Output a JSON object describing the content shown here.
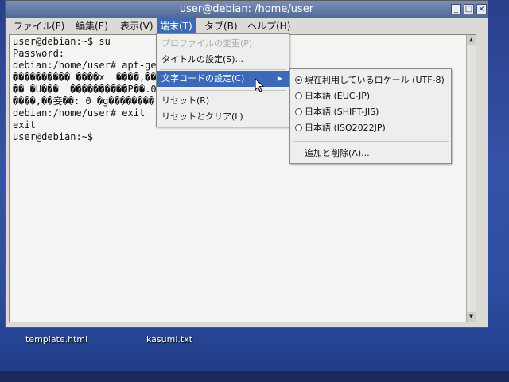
{
  "window": {
    "title": "user@debian: /home/user",
    "min": "_",
    "max": "□",
    "close": "×"
  },
  "menubar": [
    {
      "label": "ファイル(F)"
    },
    {
      "label": "編集(E)"
    },
    {
      "label": "表示(V)"
    },
    {
      "label": "端末(T)"
    },
    {
      "label": "タブ(B)"
    },
    {
      "label": "ヘルプ(H)"
    }
  ],
  "terminal": {
    "lines": [
      "user@debian:~$ su",
      "Password:",
      "debian:/home/user# apt-ge",
      "���������� ����x  ����,��",
      "�� �U���  ����������P��.0.",
      "����,��妾��: 0 �g��������",
      "debian:/home/user# exit",
      "exit",
      "user@debian:~$"
    ]
  },
  "terminal_menu": {
    "items": [
      {
        "label": "プロファイルの変更(P)",
        "state": "disabled"
      },
      {
        "label": "タイトルの設定(S)...",
        "state": "normal"
      },
      {
        "label": "文字コードの設定(C)",
        "state": "active",
        "submenu": true
      },
      {
        "label": "リセット(R)",
        "state": "normal"
      },
      {
        "label": "リセットとクリア(L)",
        "state": "normal"
      }
    ]
  },
  "encoding_submenu": {
    "items": [
      {
        "label": "現在利用しているロケール (UTF-8)",
        "checked": true
      },
      {
        "label": "日本語 (EUC-JP)",
        "checked": false
      },
      {
        "label": "日本語 (SHIFT-JIS)",
        "checked": false
      },
      {
        "label": "日本語 (ISO2022JP)",
        "checked": false
      }
    ],
    "add_remove": "追加と削除(A)..."
  },
  "desktop": {
    "files": [
      {
        "label": "template.html"
      },
      {
        "label": "kasumi.txt"
      }
    ]
  },
  "colors": {
    "accent": "#3a6ab8",
    "desktop": "#3553a8"
  },
  "icons": {
    "submenu": "triangle-right",
    "scroll_up": "triangle-up",
    "scroll_down": "triangle-down",
    "pointer": "mouse-pointer"
  }
}
